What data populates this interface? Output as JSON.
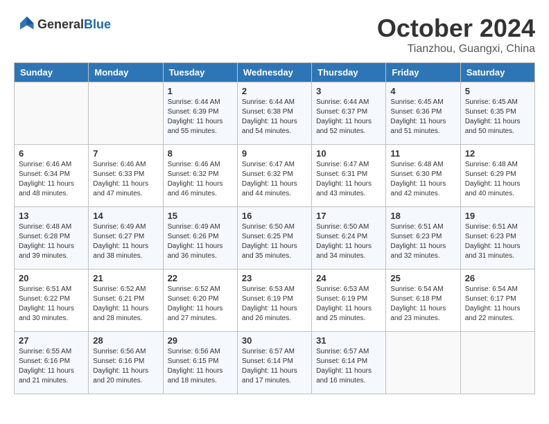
{
  "header": {
    "logo_general": "General",
    "logo_blue": "Blue",
    "month_title": "October 2024",
    "location": "Tianzhou, Guangxi, China"
  },
  "days_of_week": [
    "Sunday",
    "Monday",
    "Tuesday",
    "Wednesday",
    "Thursday",
    "Friday",
    "Saturday"
  ],
  "weeks": [
    [
      {
        "day": "",
        "info": ""
      },
      {
        "day": "",
        "info": ""
      },
      {
        "day": "1",
        "info": "Sunrise: 6:44 AM\nSunset: 6:39 PM\nDaylight: 11 hours and 55 minutes."
      },
      {
        "day": "2",
        "info": "Sunrise: 6:44 AM\nSunset: 6:38 PM\nDaylight: 11 hours and 54 minutes."
      },
      {
        "day": "3",
        "info": "Sunrise: 6:44 AM\nSunset: 6:37 PM\nDaylight: 11 hours and 52 minutes."
      },
      {
        "day": "4",
        "info": "Sunrise: 6:45 AM\nSunset: 6:36 PM\nDaylight: 11 hours and 51 minutes."
      },
      {
        "day": "5",
        "info": "Sunrise: 6:45 AM\nSunset: 6:35 PM\nDaylight: 11 hours and 50 minutes."
      }
    ],
    [
      {
        "day": "6",
        "info": "Sunrise: 6:46 AM\nSunset: 6:34 PM\nDaylight: 11 hours and 48 minutes."
      },
      {
        "day": "7",
        "info": "Sunrise: 6:46 AM\nSunset: 6:33 PM\nDaylight: 11 hours and 47 minutes."
      },
      {
        "day": "8",
        "info": "Sunrise: 6:46 AM\nSunset: 6:32 PM\nDaylight: 11 hours and 46 minutes."
      },
      {
        "day": "9",
        "info": "Sunrise: 6:47 AM\nSunset: 6:32 PM\nDaylight: 11 hours and 44 minutes."
      },
      {
        "day": "10",
        "info": "Sunrise: 6:47 AM\nSunset: 6:31 PM\nDaylight: 11 hours and 43 minutes."
      },
      {
        "day": "11",
        "info": "Sunrise: 6:48 AM\nSunset: 6:30 PM\nDaylight: 11 hours and 42 minutes."
      },
      {
        "day": "12",
        "info": "Sunrise: 6:48 AM\nSunset: 6:29 PM\nDaylight: 11 hours and 40 minutes."
      }
    ],
    [
      {
        "day": "13",
        "info": "Sunrise: 6:48 AM\nSunset: 6:28 PM\nDaylight: 11 hours and 39 minutes."
      },
      {
        "day": "14",
        "info": "Sunrise: 6:49 AM\nSunset: 6:27 PM\nDaylight: 11 hours and 38 minutes."
      },
      {
        "day": "15",
        "info": "Sunrise: 6:49 AM\nSunset: 6:26 PM\nDaylight: 11 hours and 36 minutes."
      },
      {
        "day": "16",
        "info": "Sunrise: 6:50 AM\nSunset: 6:25 PM\nDaylight: 11 hours and 35 minutes."
      },
      {
        "day": "17",
        "info": "Sunrise: 6:50 AM\nSunset: 6:24 PM\nDaylight: 11 hours and 34 minutes."
      },
      {
        "day": "18",
        "info": "Sunrise: 6:51 AM\nSunset: 6:23 PM\nDaylight: 11 hours and 32 minutes."
      },
      {
        "day": "19",
        "info": "Sunrise: 6:51 AM\nSunset: 6:23 PM\nDaylight: 11 hours and 31 minutes."
      }
    ],
    [
      {
        "day": "20",
        "info": "Sunrise: 6:51 AM\nSunset: 6:22 PM\nDaylight: 11 hours and 30 minutes."
      },
      {
        "day": "21",
        "info": "Sunrise: 6:52 AM\nSunset: 6:21 PM\nDaylight: 11 hours and 28 minutes."
      },
      {
        "day": "22",
        "info": "Sunrise: 6:52 AM\nSunset: 6:20 PM\nDaylight: 11 hours and 27 minutes."
      },
      {
        "day": "23",
        "info": "Sunrise: 6:53 AM\nSunset: 6:19 PM\nDaylight: 11 hours and 26 minutes."
      },
      {
        "day": "24",
        "info": "Sunrise: 6:53 AM\nSunset: 6:19 PM\nDaylight: 11 hours and 25 minutes."
      },
      {
        "day": "25",
        "info": "Sunrise: 6:54 AM\nSunset: 6:18 PM\nDaylight: 11 hours and 23 minutes."
      },
      {
        "day": "26",
        "info": "Sunrise: 6:54 AM\nSunset: 6:17 PM\nDaylight: 11 hours and 22 minutes."
      }
    ],
    [
      {
        "day": "27",
        "info": "Sunrise: 6:55 AM\nSunset: 6:16 PM\nDaylight: 11 hours and 21 minutes."
      },
      {
        "day": "28",
        "info": "Sunrise: 6:56 AM\nSunset: 6:16 PM\nDaylight: 11 hours and 20 minutes."
      },
      {
        "day": "29",
        "info": "Sunrise: 6:56 AM\nSunset: 6:15 PM\nDaylight: 11 hours and 18 minutes."
      },
      {
        "day": "30",
        "info": "Sunrise: 6:57 AM\nSunset: 6:14 PM\nDaylight: 11 hours and 17 minutes."
      },
      {
        "day": "31",
        "info": "Sunrise: 6:57 AM\nSunset: 6:14 PM\nDaylight: 11 hours and 16 minutes."
      },
      {
        "day": "",
        "info": ""
      },
      {
        "day": "",
        "info": ""
      }
    ]
  ]
}
